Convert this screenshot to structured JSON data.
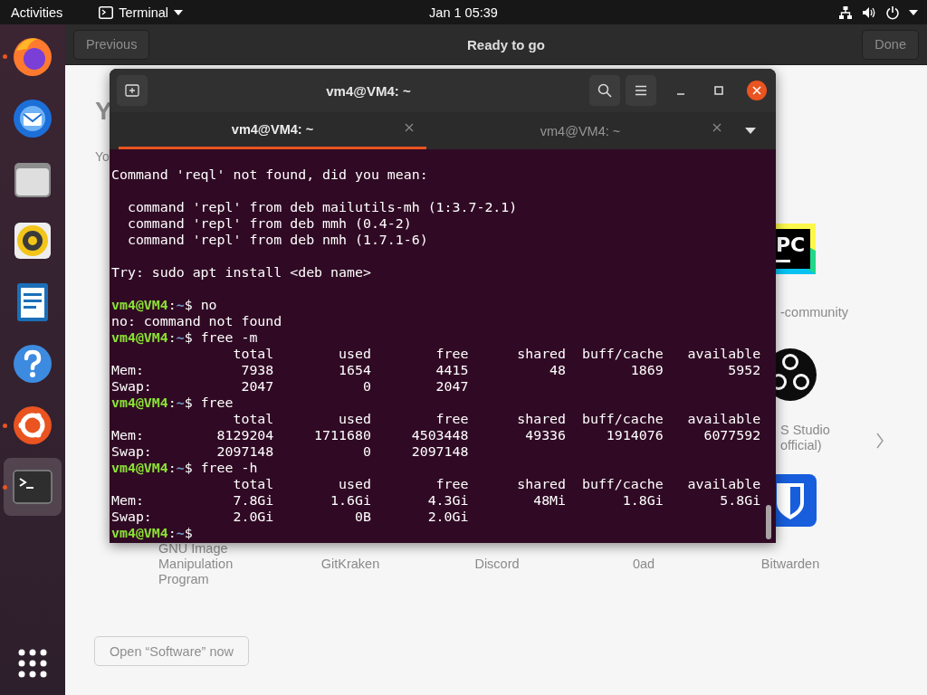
{
  "top_bar": {
    "activities": "Activities",
    "app_menu": "Terminal",
    "clock": "Jan 1  05:39"
  },
  "dock": {
    "items": [
      {
        "kind": "firefox",
        "running": true,
        "selected": false
      },
      {
        "kind": "thunderbird",
        "running": false,
        "selected": false
      },
      {
        "kind": "files",
        "running": false,
        "selected": false
      },
      {
        "kind": "rhythmbox",
        "running": false,
        "selected": false
      },
      {
        "kind": "writer",
        "running": false,
        "selected": false
      },
      {
        "kind": "help",
        "running": false,
        "selected": false
      },
      {
        "kind": "software",
        "running": true,
        "selected": false
      },
      {
        "kind": "terminal",
        "running": true,
        "selected": true
      }
    ]
  },
  "welcome_window": {
    "title": "Ready to go",
    "back_button": "Previous",
    "done_button": "Done",
    "heading": "Y",
    "subtitle": "Yo",
    "app_rows": [
      [
        {
          "kind": "pycharm",
          "logo_text": "PC",
          "label_lines": [
            "-community"
          ]
        }
      ],
      [
        {
          "kind": "obs",
          "label_lines": [
            "S Studio",
            "official)"
          ]
        }
      ],
      [
        {
          "kind": "plain",
          "label_lines": [
            "GNU Image Manipulation Program"
          ]
        },
        {
          "kind": "plain",
          "label_lines": [
            "GitKraken"
          ]
        },
        {
          "kind": "plain",
          "label_lines": [
            "Discord"
          ]
        },
        {
          "kind": "plain",
          "label_lines": [
            "0ad"
          ]
        },
        {
          "kind": "bitwarden",
          "label_lines": [
            "Bitwarden"
          ]
        }
      ]
    ],
    "open_button": "Open “Software” now"
  },
  "terminal": {
    "title": "vm4@VM4: ~",
    "tabs": [
      {
        "label": "vm4@VM4: ~",
        "selected": true
      },
      {
        "label": "vm4@VM4: ~",
        "selected": false
      }
    ],
    "lines": [
      {
        "kind": "output",
        "text": "Command 'reql' not found, did you mean:"
      },
      {
        "kind": "blank"
      },
      {
        "kind": "output",
        "text": "  command 'repl' from deb mailutils-mh (1:3.7-2.1)"
      },
      {
        "kind": "output",
        "text": "  command 'repl' from deb mmh (0.4-2)"
      },
      {
        "kind": "output",
        "text": "  command 'repl' from deb nmh (1.7.1-6)"
      },
      {
        "kind": "blank"
      },
      {
        "kind": "output",
        "text": "Try: sudo apt install <deb name>"
      },
      {
        "kind": "blank"
      },
      {
        "kind": "prompt",
        "user": "vm4@VM4",
        "separator": ":",
        "path": "~",
        "symbol": "$",
        "command": "no"
      },
      {
        "kind": "output",
        "text": "no: command not found"
      },
      {
        "kind": "prompt",
        "user": "vm4@VM4",
        "separator": ":",
        "path": "~",
        "symbol": "$",
        "command": "free -m"
      },
      {
        "kind": "output",
        "text": "               total        used        free      shared  buff/cache   available"
      },
      {
        "kind": "output",
        "text": "Mem:            7938        1654        4415          48        1869        5952"
      },
      {
        "kind": "output",
        "text": "Swap:           2047           0        2047"
      },
      {
        "kind": "prompt",
        "user": "vm4@VM4",
        "separator": ":",
        "path": "~",
        "symbol": "$",
        "command": "free"
      },
      {
        "kind": "output",
        "text": "               total        used        free      shared  buff/cache   available"
      },
      {
        "kind": "output",
        "text": "Mem:         8129204     1711680     4503448       49336     1914076     6077592"
      },
      {
        "kind": "output",
        "text": "Swap:        2097148           0     2097148"
      },
      {
        "kind": "prompt",
        "user": "vm4@VM4",
        "separator": ":",
        "path": "~",
        "symbol": "$",
        "command": "free -h"
      },
      {
        "kind": "output",
        "text": "               total        used        free      shared  buff/cache   available"
      },
      {
        "kind": "output",
        "text": "Mem:           7.8Gi       1.6Gi       4.3Gi        48Mi       1.8Gi       5.8Gi"
      },
      {
        "kind": "output",
        "text": "Swap:          2.0Gi          0B       2.0Gi"
      },
      {
        "kind": "prompt",
        "user": "vm4@VM4",
        "separator": ":",
        "path": "~",
        "symbol": "$"
      }
    ]
  }
}
